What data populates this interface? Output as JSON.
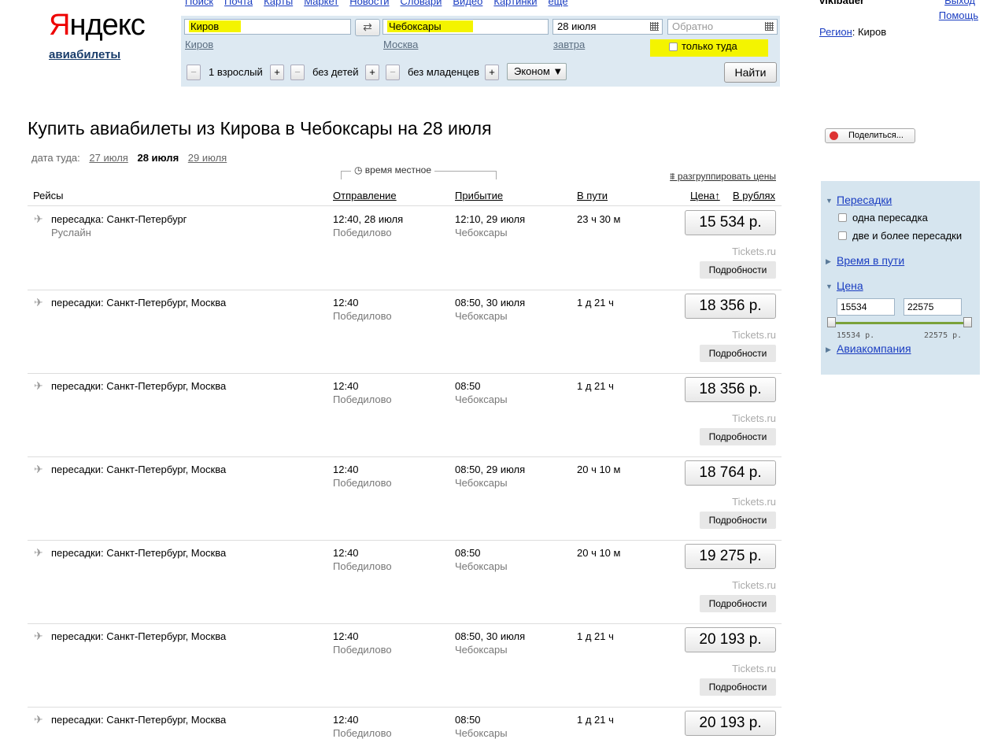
{
  "topnav": [
    "Поиск",
    "Почта",
    "Карты",
    "Маркет",
    "Новости",
    "Словари",
    "Видео",
    "Картинки",
    "ещё"
  ],
  "logo": {
    "first": "Я",
    "rest": "ндекс",
    "service": "авиабилеты"
  },
  "user": {
    "name": "vikibauer",
    "logout": "Выход",
    "help": "Помощь",
    "region_label": "Регион",
    "region_value": ": Киров"
  },
  "search": {
    "from": "Киров",
    "from_hint": "Киров",
    "to": "Чебоксары",
    "to_hint": "Москва",
    "swap": "⇄",
    "date": "28 июля",
    "date_hint": "завтра",
    "return_placeholder": "Обратно",
    "oneway": "только туда",
    "adults": "1 взрослый",
    "children": "без детей",
    "infants": "без младенцев",
    "minus": "−",
    "plus": "+",
    "class": "Эконом ▼",
    "find": "Найти"
  },
  "page": {
    "title": "Купить авиабилеты из Кирова в Чебоксары на 28 июля",
    "dates_label": "дата туда:",
    "dates": [
      {
        "label": "27 июля"
      },
      {
        "label": "28 июля"
      },
      {
        "label": "29 июля"
      }
    ],
    "local_time": "◷ время местное",
    "ungroup": "⩩ разгруппировать цены"
  },
  "columns": {
    "flights": "Рейсы",
    "departure": "Отправление",
    "arrival": "Прибытие",
    "duration": "В пути",
    "price": "Цена↑",
    "currency": "В рублях"
  },
  "flights": [
    {
      "route": "пересадка: Санкт-Петербург",
      "carrier": "Руслайн",
      "dep": "12:40, 28 июля",
      "dep_ap": "Победилово",
      "arr": "12:10, 29 июля",
      "arr_ap": "Чебоксары",
      "dur": "23 ч 30 м",
      "price": "15 534 р.",
      "agent": "Tickets.ru",
      "details": "Подробности"
    },
    {
      "route": "пересадки: Санкт-Петербург, Москва",
      "carrier": "",
      "dep": "12:40",
      "dep_ap": "Победилово",
      "arr": "08:50, 30 июля",
      "arr_ap": "Чебоксары",
      "dur": "1 д 21 ч",
      "price": "18 356 р.",
      "agent": "Tickets.ru",
      "details": "Подробности"
    },
    {
      "route": "пересадки: Санкт-Петербург, Москва",
      "carrier": "",
      "dep": "12:40",
      "dep_ap": "Победилово",
      "arr": "08:50",
      "arr_ap": "Чебоксары",
      "dur": "1 д 21 ч",
      "price": "18 356 р.",
      "agent": "Tickets.ru",
      "details": "Подробности"
    },
    {
      "route": "пересадки: Санкт-Петербург, Москва",
      "carrier": "",
      "dep": "12:40",
      "dep_ap": "Победилово",
      "arr": "08:50, 29 июля",
      "arr_ap": "Чебоксары",
      "dur": "20 ч 10 м",
      "price": "18 764 р.",
      "agent": "Tickets.ru",
      "details": "Подробности"
    },
    {
      "route": "пересадки: Санкт-Петербург, Москва",
      "carrier": "",
      "dep": "12:40",
      "dep_ap": "Победилово",
      "arr": "08:50",
      "arr_ap": "Чебоксары",
      "dur": "20 ч 10 м",
      "price": "19 275 р.",
      "agent": "Tickets.ru",
      "details": "Подробности"
    },
    {
      "route": "пересадки: Санкт-Петербург, Москва",
      "carrier": "",
      "dep": "12:40",
      "dep_ap": "Победилово",
      "arr": "08:50, 30 июля",
      "arr_ap": "Чебоксары",
      "dur": "1 д 21 ч",
      "price": "20 193 р.",
      "agent": "Tickets.ru",
      "details": "Подробности"
    },
    {
      "route": "пересадки: Санкт-Петербург, Москва",
      "carrier": "",
      "dep": "12:40",
      "dep_ap": "Победилово",
      "arr": "08:50",
      "arr_ap": "Чебоксары",
      "dur": "1 д 21 ч",
      "price": "20 193 р.",
      "agent": "",
      "details": ""
    }
  ],
  "share": "Поделиться...",
  "filters": {
    "transfers": "Пересадки",
    "one": "одна пересадка",
    "two": "две и более пересадки",
    "duration": "Время в пути",
    "price": "Цена",
    "min": "15534",
    "max": "22575",
    "min_label": "15534 р.",
    "max_label": "22575 р.",
    "airline": "Авиакомпания"
  },
  "colors": {
    "highlight": "#f4f400",
    "link": "#1a3dc1",
    "filter_bg": "#d6e5ef",
    "slider": "#7aa13a"
  }
}
